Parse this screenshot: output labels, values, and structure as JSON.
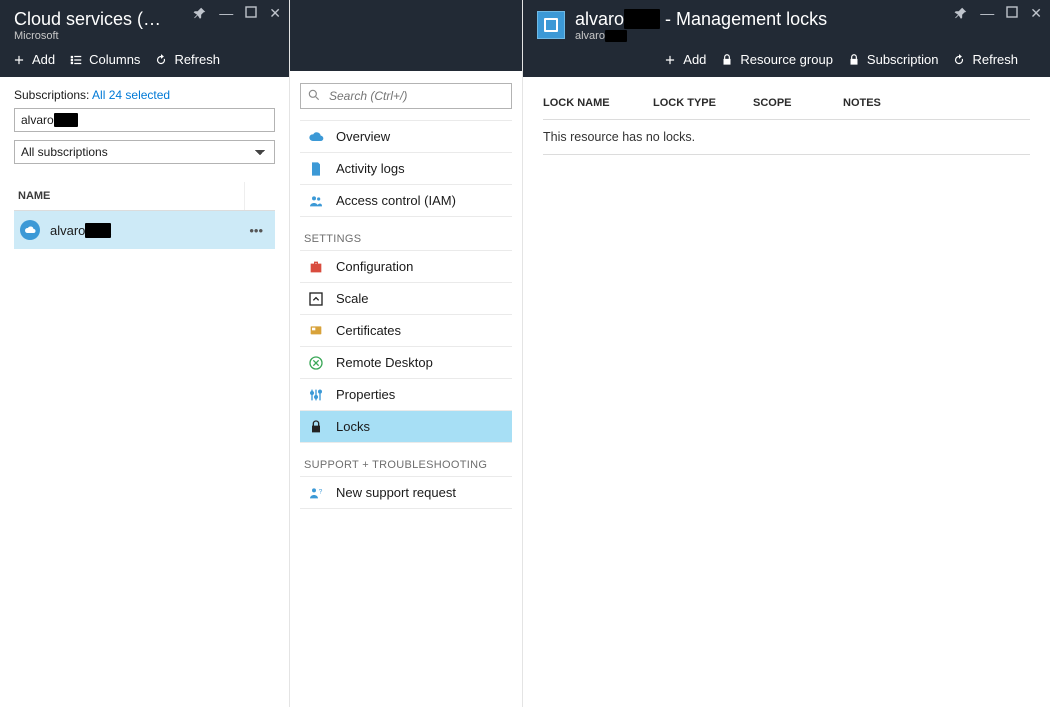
{
  "left": {
    "title_prefix": "Cloud services (cl...",
    "subtitle": "Microsoft",
    "toolbar": {
      "add": "Add",
      "columns": "Columns",
      "refresh": "Refresh"
    },
    "subscriptions_label": "Subscriptions:",
    "subscriptions_link": "All 24 selected",
    "filter_value": "alvaro",
    "subs_dropdown": "All subscriptions",
    "grid_header": "NAME",
    "rows": [
      {
        "name_prefix": "alvaro"
      }
    ]
  },
  "middle": {
    "search_placeholder": "Search (Ctrl+/)",
    "sections": [
      {
        "title": "",
        "items": [
          {
            "key": "overview",
            "label": "Overview",
            "icon": "cloud",
            "tint": "c-blue"
          },
          {
            "key": "activity",
            "label": "Activity logs",
            "icon": "doc",
            "tint": "c-blue"
          },
          {
            "key": "iam",
            "label": "Access control (IAM)",
            "icon": "people",
            "tint": "c-blue"
          }
        ]
      },
      {
        "title": "SETTINGS",
        "items": [
          {
            "key": "config",
            "label": "Configuration",
            "icon": "briefcase",
            "tint": "c-red"
          },
          {
            "key": "scale",
            "label": "Scale",
            "icon": "arrow-up",
            "tint": "c-dk"
          },
          {
            "key": "certs",
            "label": "Certificates",
            "icon": "badge",
            "tint": "c-gold"
          },
          {
            "key": "rdp",
            "label": "Remote Desktop",
            "icon": "circle-x",
            "tint": "c-green"
          },
          {
            "key": "props",
            "label": "Properties",
            "icon": "sliders",
            "tint": "c-blue"
          },
          {
            "key": "locks",
            "label": "Locks",
            "icon": "lock",
            "tint": "c-dk",
            "active": true
          }
        ]
      },
      {
        "title": "SUPPORT + TROUBLESHOOTING",
        "items": [
          {
            "key": "support",
            "label": "New support request",
            "icon": "person-q",
            "tint": "c-blue"
          }
        ]
      }
    ]
  },
  "right": {
    "title_prefix": "alvaro",
    "title_suffix": " - Management locks",
    "subtitle_prefix": "alvaro",
    "toolbar": {
      "add": "Add",
      "rg": "Resource group",
      "sub": "Subscription",
      "refresh": "Refresh"
    },
    "cols": {
      "c1": "LOCK NAME",
      "c2": "LOCK TYPE",
      "c3": "SCOPE",
      "c4": "NOTES"
    },
    "empty": "This resource has no locks."
  }
}
